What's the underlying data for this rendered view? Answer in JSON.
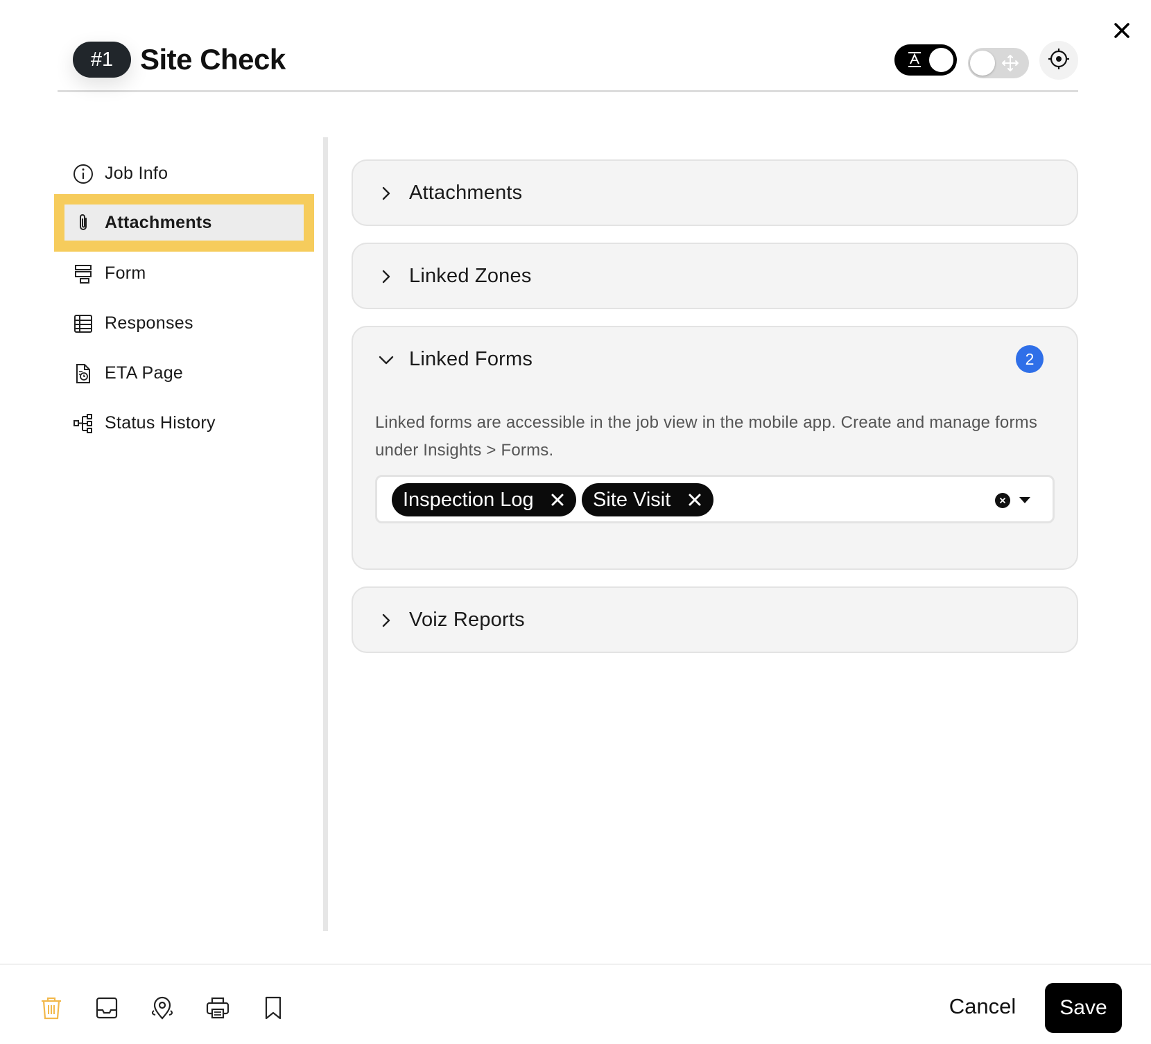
{
  "header": {
    "job_number": "#1",
    "title": "Site Check",
    "text_toggle_on": true,
    "move_toggle_on": false
  },
  "sidebar": {
    "items": [
      {
        "label": "Job Info",
        "icon": "info-icon"
      },
      {
        "label": "Attachments",
        "icon": "paperclip-icon",
        "active": true
      },
      {
        "label": "Form",
        "icon": "form-icon"
      },
      {
        "label": "Responses",
        "icon": "table-icon"
      },
      {
        "label": "ETA Page",
        "icon": "document-clock-icon"
      },
      {
        "label": "Status History",
        "icon": "hierarchy-icon"
      }
    ]
  },
  "panels": {
    "attachments": {
      "title": "Attachments",
      "expanded": false
    },
    "linked_zones": {
      "title": "Linked Zones",
      "expanded": false
    },
    "linked_forms": {
      "title": "Linked Forms",
      "expanded": true,
      "count": "2",
      "description": "Linked forms are accessible in the job view in the mobile app. Create and manage forms under Insights > Forms.",
      "selected": [
        "Inspection Log",
        "Site Visit"
      ]
    },
    "voiz_reports": {
      "title": "Voiz Reports",
      "expanded": false
    }
  },
  "footer": {
    "icons": [
      "trash-icon",
      "inbox-icon",
      "map-pin-icon",
      "printer-icon",
      "bookmark-icon"
    ],
    "cancel_label": "Cancel",
    "save_label": "Save"
  },
  "colors": {
    "highlight": "#f6cc5c",
    "badge_blue": "#2f6fe8",
    "trash_orange": "#f2b84b"
  }
}
